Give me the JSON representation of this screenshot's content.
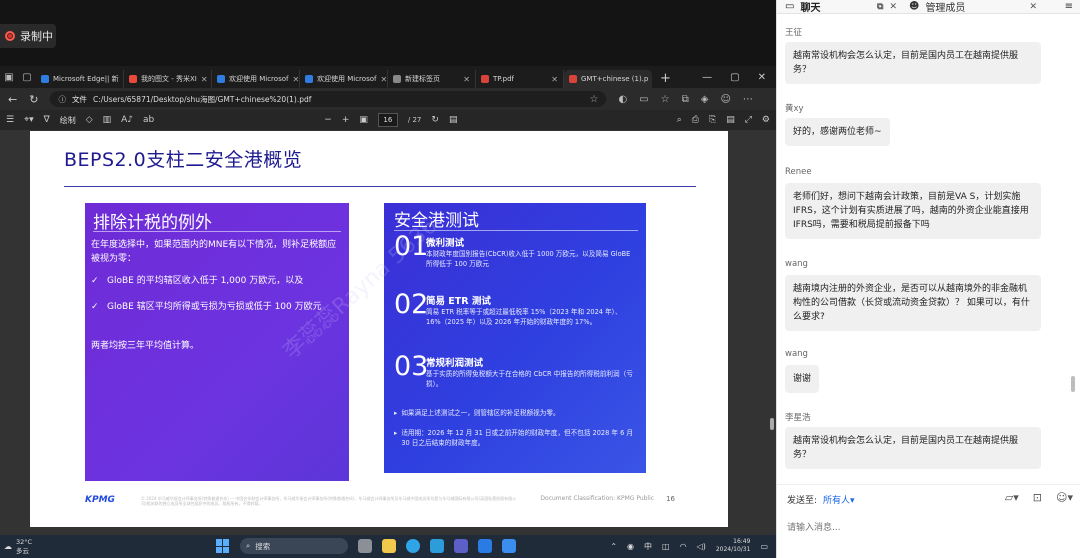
{
  "meeting": {
    "record_label": "录制中"
  },
  "browser": {
    "tabs": [
      {
        "label": "Microsoft Edge|| 新",
        "color": "#2f7de1"
      },
      {
        "label": "我的图文 - 秀米XI",
        "color": "#e84a3c"
      },
      {
        "label": "欢迎使用 Microsof",
        "color": "#2f7de1"
      },
      {
        "label": "欢迎使用 Microsof",
        "color": "#2f7de1"
      },
      {
        "label": "新建标签页",
        "color": "#888888"
      },
      {
        "label": "TP.pdf",
        "color": "#d9443a"
      },
      {
        "label": "GMT+chinese (1).p",
        "color": "#d9443a"
      }
    ],
    "address": {
      "scheme": "文件",
      "path": "C:/Users/65871/Desktop/shu海图/GMT+chinese%20(1).pdf"
    },
    "pdf_toolbar": {
      "draw_label": "绘制",
      "page_current": "16",
      "page_total": "/ 27"
    }
  },
  "slide": {
    "title": "BEPS2.0支柱二安全港概览",
    "left_panel": {
      "title": "排除计税的例外",
      "intro": "在年度选择中，如果范围内的MNE有以下情况，则补足税额应被视为零：",
      "items": [
        "GloBE 的平均辖区收入低于 1,000 万欧元，以及",
        "GloBE 辖区平均所得或亏损为亏损或低于 100 万欧元"
      ],
      "note": "两者均按三年平均值计算。"
    },
    "right_panel": {
      "title": "安全港测试",
      "tests": [
        {
          "num": "01",
          "title": "微利测试",
          "desc": "本财政年度国别报告(CbCR)收入低于 1000 万欧元，以及简易 GloBE 所得低于 100 万欧元"
        },
        {
          "num": "02",
          "title": "简易 ETR 测试",
          "desc": "简易 ETR 税率等于或超过最低税率 15%（2023 年和 2024 年）、16%（2025 年）以及 2026 年开始的财政年度的 17%。"
        },
        {
          "num": "03",
          "title": "常规利润测试",
          "desc": "基于实质的所得免税额大于在合格的 CbCR 中报告的所得税前利润（亏损）。"
        }
      ],
      "bullets": [
        "如果满足上述测试之一，则管辖区的补足税额视为零。",
        "适用期：2026 年 12 月 31 日或之前开始的财政年度，但不包括 2028 年 6 月 30 日之后结束的财政年度。"
      ]
    },
    "watermark": "李蕊蕊Rayna 5636",
    "footer": {
      "logo": "KPMG",
      "legal": "© 2024 毕马威华振会计师事务所(特殊普通合伙) — 中国合伙制会计师事务所，毕马威华振会计师事务所(特殊普通合伙)、毕马威会计师事务所及毕马威中国成员所均是与毕马威国际有限公司(英国私营担保有限公司)相关联的独立成员所全球性组织中的成员。版权所有，不得转载。",
      "doc_code": "Document Classification: KPMG Public",
      "page": "16"
    }
  },
  "taskbar": {
    "temp": "32°C",
    "weather": "多云",
    "search_placeholder": "搜索",
    "ime": "中",
    "time": "16:49",
    "date": "2024/10/31"
  },
  "chat": {
    "tabs": {
      "chat": "聊天",
      "members": "管理成员"
    },
    "messages": [
      {
        "sender": "王征",
        "text": "越南常设机构会怎么认定，目前是国内员工在越南提供服务？"
      },
      {
        "sender": "黄xy",
        "text": "好的，感谢两位老师~"
      },
      {
        "sender": "Renee",
        "text": "老师们好，想问下越南会计政策，目前是VA S，计划实施IFRS，这个计划有实质进展了吗，越南的外资企业能直接用IFRS吗，需要和税局提前报备下吗"
      },
      {
        "sender": "wang",
        "text": "越南境内注册的外资企业，是否可以从越南境外的非金融机构性的公司借款（长贷或流动资金贷款）？ 如果可以，有什么要求?"
      },
      {
        "sender": "wang",
        "text": "谢谢"
      },
      {
        "sender": "李星浩",
        "text": "越南常设机构会怎么认定，目前是国内员工在越南提供服务？"
      }
    ],
    "send_to_label": "发送至:",
    "send_to_value": "所有人▾",
    "input_placeholder": "请输入消息..."
  }
}
